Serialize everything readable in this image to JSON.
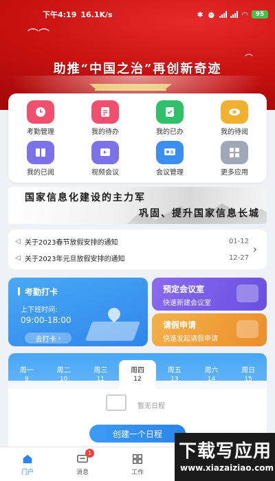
{
  "status_bar": {
    "time": "下午4:19",
    "speed": "16.1K/s",
    "battery": "95"
  },
  "header": {
    "slogan": "助推“中国之治”再创新奇迹"
  },
  "apps": [
    {
      "label": "考勤管理",
      "color": "#f0506e",
      "icon": "clock-icon"
    },
    {
      "label": "我的待办",
      "color": "#f0506e",
      "icon": "edit-doc-icon"
    },
    {
      "label": "我的已办",
      "color": "#2fc06a",
      "icon": "check-doc-icon"
    },
    {
      "label": "我的待阅",
      "color": "#f3b030",
      "icon": "eye-icon"
    },
    {
      "label": "我的已阅",
      "color": "#7b72e9",
      "icon": "book-icon"
    },
    {
      "label": "视频会议",
      "color": "#7b72e9",
      "icon": "video-icon"
    },
    {
      "label": "会议管理",
      "color": "#3a8ff0",
      "icon": "presentation-icon"
    },
    {
      "label": "更多应用",
      "color": "#a0a8b8",
      "icon": "grid-icon"
    }
  ],
  "ink_banner": {
    "line1": "国家信息化建设的主力军",
    "line2": "巩固、提升国家信息长城"
  },
  "notices": [
    {
      "title": "关于2023春节放假安排的通知",
      "date": "01-12"
    },
    {
      "title": "关于2023年元旦放假安排的通知",
      "date": "12-27"
    }
  ],
  "attendance": {
    "title": "考勤打卡",
    "label": "上下班时间:",
    "time": "09:00-18:00",
    "button": "去打卡"
  },
  "meeting": {
    "title": "预定会议室",
    "sub": "快速新建会议室"
  },
  "leave": {
    "title": "请假申请",
    "sub": "快速发起请假申请"
  },
  "calendar": {
    "days": [
      {
        "name": "周一",
        "num": "9"
      },
      {
        "name": "周二",
        "num": "10"
      },
      {
        "name": "周三",
        "num": "11"
      },
      {
        "name": "周四",
        "num": "12"
      },
      {
        "name": "周五",
        "num": "13"
      },
      {
        "name": "周六",
        "num": "14"
      },
      {
        "name": "周日",
        "num": "15"
      }
    ],
    "empty": "暂无日程",
    "create": "创建一个日程"
  },
  "tabs": [
    {
      "label": "门户",
      "icon": "home-icon"
    },
    {
      "label": "消息",
      "icon": "message-icon",
      "badge": "1"
    },
    {
      "label": "工作",
      "icon": "apps-icon"
    },
    {
      "label": "",
      "icon": ""
    },
    {
      "label": "",
      "icon": ""
    }
  ],
  "watermark": {
    "cn": "下载写应用",
    "en": "www.xiazaiziao.com"
  }
}
